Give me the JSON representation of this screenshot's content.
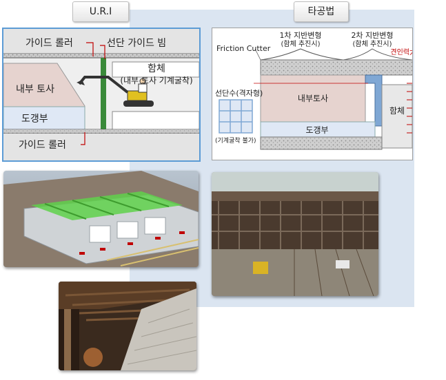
{
  "headers": {
    "uri": "U.R.I",
    "other": "타공법"
  },
  "uri_diagram": {
    "guide_roller_top": "가이드 롤러",
    "front_guide_beam": "선단 가이드 빔",
    "box_label": "함체",
    "box_sub": "(내부 토사 기계굴착)",
    "inner_soil": "내부 토사",
    "culvert": "도갱부",
    "guide_roller_bottom": "가이드 롤러"
  },
  "other_diagram": {
    "friction_cutter": "Friction Cutter",
    "deform1_title": "1차 지반변형",
    "deform1_sub": "(함체 추진시)",
    "deform2_title": "2차 지반변형",
    "deform2_sub": "(함체 추진시)",
    "traction": "견인력大",
    "partition_title": "선단수(격자형)",
    "partition_note": "(기계굴착 불가)",
    "inner_soil": "내부토사",
    "box_label": "함체",
    "culvert": "도갱부"
  },
  "colors": {
    "uri_frame": "#5b9bd5",
    "red_leader": "#c00000",
    "green_structure": "#3a8a3a",
    "soil_pink": "#e6d3cf",
    "culvert_blue": "#dfe8f5",
    "steel_blue": "#7fa7d4",
    "gravel": "#bcbcbc",
    "bg_panel": "#dbe5f1"
  }
}
